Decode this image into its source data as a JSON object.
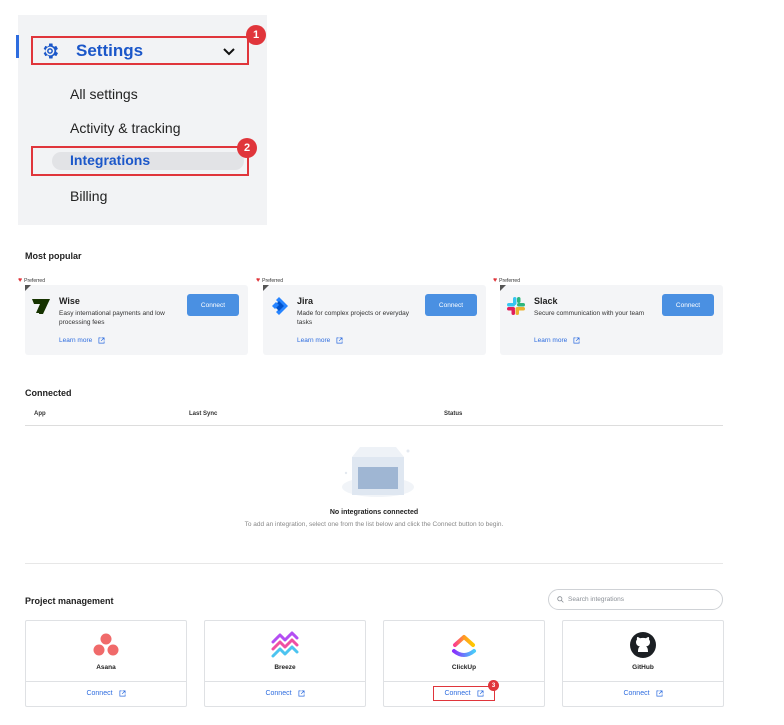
{
  "menu": {
    "settings_label": "Settings",
    "items": [
      "All settings",
      "Activity & tracking",
      "Integrations",
      "Billing"
    ],
    "step_badges": [
      "1",
      "2"
    ]
  },
  "most_popular": {
    "title": "Most popular",
    "preferred_label": "Preferred",
    "learn_more_label": "Learn more",
    "connect_label": "Connect",
    "cards": [
      {
        "name": "Wise",
        "description": "Easy international payments and low processing fees",
        "icon": "wise-logo"
      },
      {
        "name": "Jira",
        "description": "Made for complex projects or everyday tasks",
        "icon": "jira-logo"
      },
      {
        "name": "Slack",
        "description": "Secure communication with your team",
        "icon": "slack-logo"
      }
    ]
  },
  "connected": {
    "title": "Connected",
    "columns": [
      "App",
      "Last Sync",
      "Status"
    ],
    "empty_title": "No integrations connected",
    "empty_subtitle": "To add an integration, select one from the list below and click the Connect button to begin."
  },
  "project_management": {
    "title": "Project management",
    "search_placeholder": "Search integrations",
    "connect_label": "Connect",
    "step_badge": "3",
    "apps": [
      {
        "name": "Asana",
        "icon": "asana-logo"
      },
      {
        "name": "Breeze",
        "icon": "breeze-logo"
      },
      {
        "name": "ClickUp",
        "icon": "clickup-logo"
      },
      {
        "name": "GitHub",
        "icon": "github-logo"
      }
    ]
  },
  "colors": {
    "accent": "#2d6cdf",
    "connect_button": "#4a90e2",
    "annotation_red": "#e0353b",
    "menu_bg": "#f2f3f5"
  }
}
